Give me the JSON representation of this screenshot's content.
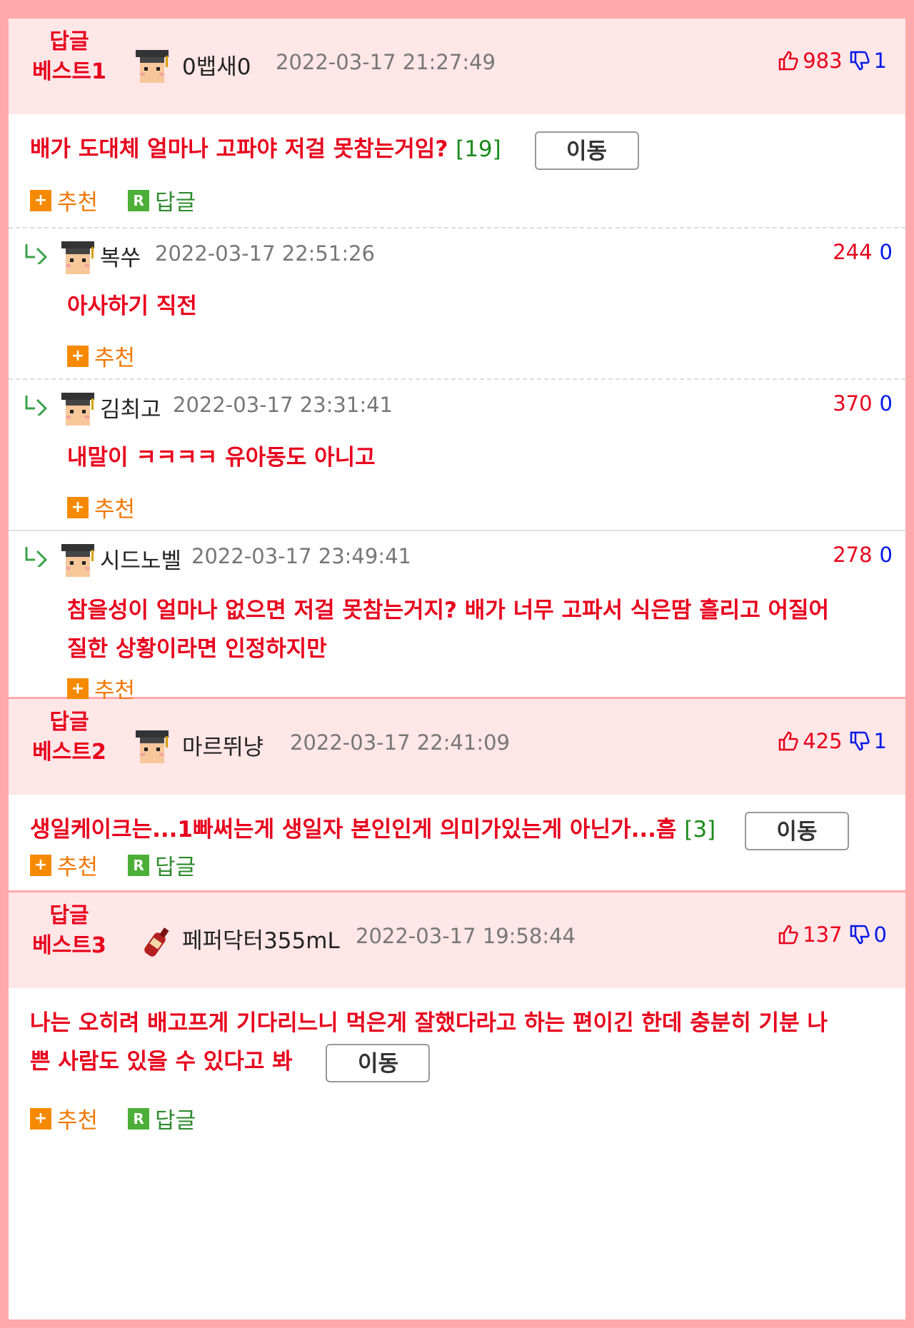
{
  "best1": {
    "label_line1": "답글",
    "label_line2": "베스트1",
    "nick": "0뱁새0",
    "date": "2022-03-17 21:27:49",
    "up": "983",
    "down": "1",
    "content": "배가 도대체 얼마나 고파야 저걸 못참는거임?",
    "reply_count": "[19]",
    "move_label": "이동",
    "recommend_label": "추천",
    "reply_label": "답글",
    "replies": [
      {
        "nick": "복쑤",
        "date": "2022-03-17 22:51:26",
        "up": "244",
        "down": "0",
        "content": "아사하기 직전",
        "recommend_label": "추천"
      },
      {
        "nick": "김최고",
        "date": "2022-03-17 23:31:41",
        "up": "370",
        "down": "0",
        "content": "내말이 ㅋㅋㅋㅋ 유아동도 아니고",
        "recommend_label": "추천"
      },
      {
        "nick": "시드노벨",
        "date": "2022-03-17 23:49:41",
        "up": "278",
        "down": "0",
        "content_line1": "참을성이 얼마나 없으면 저걸 못참는거지? 배가 너무 고파서 식은땀 흘리고 어질어",
        "content_line2": "질한 상황이라면 인정하지만",
        "recommend_label": "추천"
      }
    ]
  },
  "best2": {
    "label_line1": "답글",
    "label_line2": "베스트2",
    "nick": "마르뛰냥",
    "date": "2022-03-17 22:41:09",
    "up": "425",
    "down": "1",
    "content": "생일케이크는...1빠써는게 생일자 본인인게 의미가있는게 아닌가...흠",
    "reply_count": "[3]",
    "move_label": "이동",
    "recommend_label": "추천",
    "reply_label": "답글"
  },
  "best3": {
    "label_line1": "답글",
    "label_line2": "베스트3",
    "nick": "페퍼닥터355mL",
    "date": "2022-03-17 19:58:44",
    "up": "137",
    "down": "0",
    "content_line1": "나는 오히려 배고프게 기다리느니 먹은게 잘했다라고 하는 편이긴 한데 충분히 기분 나",
    "content_line2": "쁜 사람도 있을 수 있다고 봐",
    "move_label": "이동",
    "recommend_label": "추천",
    "reply_label": "답글"
  },
  "colors": {
    "accent_red": "#e8001c",
    "down_blue": "#0018e8",
    "border_pink": "#ffa9ad",
    "head_bg": "#ffe6e7"
  }
}
